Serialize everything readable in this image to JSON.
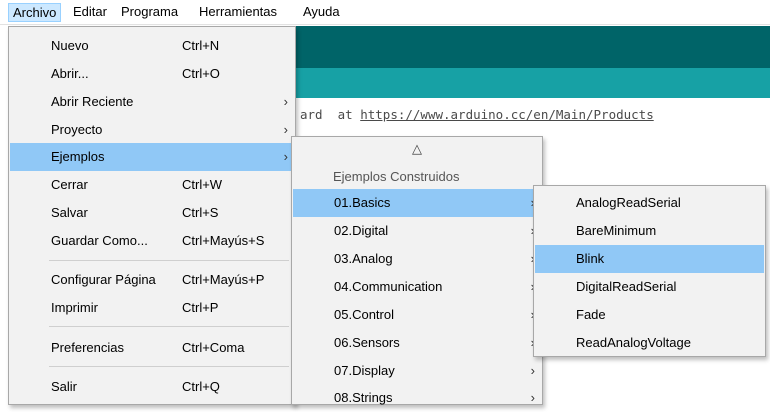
{
  "menubar": {
    "items": [
      "Archivo",
      "Editar",
      "Programa",
      "Herramientas",
      "Ayuda"
    ]
  },
  "editor": {
    "code_prefix": "ard  at ",
    "code_url": "https://www.arduino.cc/en/Main/Products"
  },
  "file_menu": {
    "items": [
      {
        "label": "Nuevo",
        "shortcut": "Ctrl+N"
      },
      {
        "label": "Abrir...",
        "shortcut": "Ctrl+O"
      },
      {
        "label": "Abrir Reciente",
        "arrow": "›"
      },
      {
        "label": "Proyecto",
        "arrow": "›"
      },
      {
        "label": "Ejemplos",
        "arrow": "›"
      },
      {
        "label": "Cerrar",
        "shortcut": "Ctrl+W"
      },
      {
        "label": "Salvar",
        "shortcut": "Ctrl+S"
      },
      {
        "label": "Guardar Como...",
        "shortcut": "Ctrl+Mayús+S"
      },
      {
        "label": "Configurar Página",
        "shortcut": "Ctrl+Mayús+P"
      },
      {
        "label": "Imprimir",
        "shortcut": "Ctrl+P"
      },
      {
        "label": "Preferencias",
        "shortcut": "Ctrl+Coma"
      },
      {
        "label": "Salir",
        "shortcut": "Ctrl+Q"
      }
    ]
  },
  "examples_menu": {
    "scroll_up": "△",
    "header": "Ejemplos Construidos",
    "items": [
      {
        "label": "01.Basics",
        "arrow": "›"
      },
      {
        "label": "02.Digital",
        "arrow": "›"
      },
      {
        "label": "03.Analog",
        "arrow": "›"
      },
      {
        "label": "04.Communication",
        "arrow": "›"
      },
      {
        "label": "05.Control",
        "arrow": "›"
      },
      {
        "label": "06.Sensors",
        "arrow": "›"
      },
      {
        "label": "07.Display",
        "arrow": "›"
      },
      {
        "label": "08.Strings",
        "arrow": "›"
      }
    ]
  },
  "basics_menu": {
    "items": [
      {
        "label": "AnalogReadSerial"
      },
      {
        "label": "BareMinimum"
      },
      {
        "label": "Blink"
      },
      {
        "label": "DigitalReadSerial"
      },
      {
        "label": "Fade"
      },
      {
        "label": "ReadAnalogVoltage"
      }
    ]
  },
  "colors": {
    "toolbar": "#006468",
    "tabs": "#17a1a5",
    "highlight": "#90c8f6",
    "menubar_active": "#cce8ff"
  }
}
